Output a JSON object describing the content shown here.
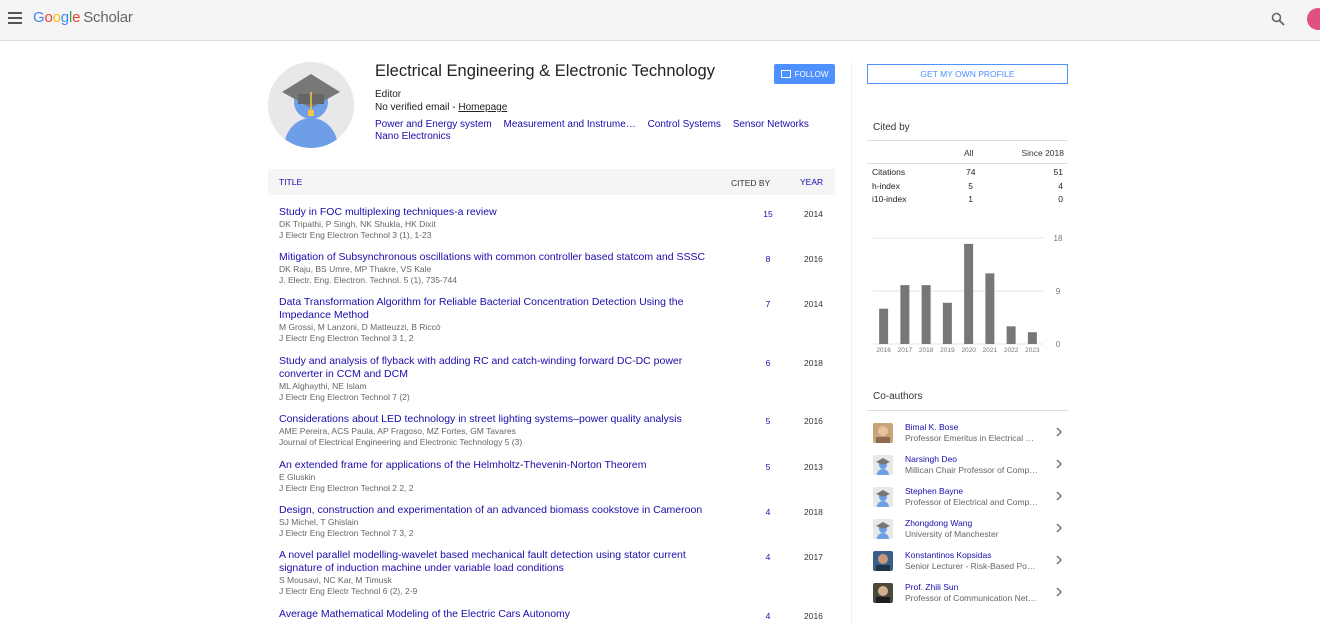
{
  "app": {
    "logo_google": [
      "G",
      "o",
      "o",
      "g",
      "l",
      "e"
    ],
    "logo_scholar": "Scholar"
  },
  "profile": {
    "name": "Electrical Engineering & Electronic Technology",
    "affiliation": "Editor",
    "email_text": "No verified email - ",
    "homepage_label": "Homepage",
    "follow_label": "FOLLOW",
    "interests": [
      "Power and Energy system",
      "Measurement and Instrume…",
      "Control Systems",
      "Sensor Networks",
      "Nano Electronics"
    ]
  },
  "table": {
    "headers": {
      "title": "TITLE",
      "cited_by": "CITED BY",
      "year": "YEAR"
    },
    "rows": [
      {
        "title": "Study in FOC multiplexing techniques-a review",
        "authors": "DK Tripathi, P Singh, NK Shukla, HK Dixit",
        "venue": "J Electr Eng Electron Technol 3 (1), 1-23",
        "cited": "15",
        "year": "2014"
      },
      {
        "title": "Mitigation of Subsynchronous oscillations with common controller based statcom and SSSC",
        "authors": "DK Raju, BS Umre, MP Thakre, VS Kale",
        "venue": "J. Electr. Eng. Electron. Technol. 5 (1), 735-744",
        "cited": "8",
        "year": "2016"
      },
      {
        "title": "Data Transformation Algorithm for Reliable Bacterial Concentration Detection Using the Impedance Method",
        "authors": "M Grossi, M Lanzoni, D Matteuzzi, B Riccò",
        "venue": "J Electr Eng Electron Technol 3 1, 2",
        "cited": "7",
        "year": "2014"
      },
      {
        "title": "Study and analysis of flyback with adding RC and catch-winding forward DC-DC power converter in CCM and DCM",
        "authors": "ML Alghaythi, NE Islam",
        "venue": "J Electr Eng Electron Technol 7 (2)",
        "cited": "6",
        "year": "2018"
      },
      {
        "title": "Considerations about LED technology in street lighting systems–power quality analysis",
        "authors": "AME Pereira, ACS Paula, AP Fragoso, MZ Fortes, GM Tavares",
        "venue": "Journal of Electrical Engineering and Electronic Technology 5 (3)",
        "cited": "5",
        "year": "2016"
      },
      {
        "title": "An extended frame for applications of the Helmholtz-Thevenin-Norton Theorem",
        "authors": "E Gluskin",
        "venue": "J Electr Eng Electron Technol 2 2, 2",
        "cited": "5",
        "year": "2013"
      },
      {
        "title": "Design, construction and experimentation of an advanced biomass cookstove in Cameroon",
        "authors": "SJ Michel, T Ghislain",
        "venue": "J Electr Eng Electron Technol 7 3, 2",
        "cited": "4",
        "year": "2018"
      },
      {
        "title": "A novel parallel modelling-wavelet based mechanical fault detection using stator current signature of induction machine under variable load conditions",
        "authors": "S Mousavi, NC Kar, M Timusk",
        "venue": "J Electr Eng Electr Technol 6 (2), 2-9",
        "cited": "4",
        "year": "2017"
      },
      {
        "title": "Average Mathematical Modeling of the Electric Cars Autonomy",
        "authors": "",
        "venue": "",
        "cited": "4",
        "year": "2016"
      }
    ]
  },
  "sidebar": {
    "get_profile_label": "GET MY OWN PROFILE",
    "cited_by": {
      "header": "Cited by",
      "col_all": "All",
      "col_since": "Since 2018",
      "rows": [
        {
          "label": "Citations",
          "all": "74",
          "since": "51"
        },
        {
          "label": "h-index",
          "all": "5",
          "since": "4"
        },
        {
          "label": "i10-index",
          "all": "1",
          "since": "0"
        }
      ]
    },
    "coauthors_header": "Co-authors",
    "coauthors": [
      {
        "name": "Bimal K. Bose",
        "affiliation": "Professor Emeritus in Electrical …",
        "avatar": "photo"
      },
      {
        "name": "Narsingh Deo",
        "affiliation": "Millican Chair Professor of Comp…",
        "avatar": "placeholder"
      },
      {
        "name": "Stephen Bayne",
        "affiliation": "Professor of Electrical and Comp…",
        "avatar": "placeholder"
      },
      {
        "name": "Zhongdong Wang",
        "affiliation": "University of Manchester",
        "avatar": "placeholder"
      },
      {
        "name": "Konstantinos Kopsidas",
        "affiliation": "Senior Lecturer - Risk-Based Po…",
        "avatar": "photo"
      },
      {
        "name": "Prof. Zhili Sun",
        "affiliation": "Professor of Communication Net…",
        "avatar": "photo"
      }
    ]
  },
  "chart_data": {
    "type": "bar",
    "categories": [
      "2016",
      "2017",
      "2018",
      "2019",
      "2020",
      "2021",
      "2022",
      "2023"
    ],
    "values": [
      6,
      10,
      10,
      7,
      17,
      12,
      3,
      2
    ],
    "yticks": [
      "18",
      "9",
      "0"
    ],
    "ylim": [
      0,
      18
    ],
    "bar_color": "#777777",
    "grid": true
  },
  "colors": {
    "link": "#1a0dab",
    "accent": "#4d90fe"
  }
}
